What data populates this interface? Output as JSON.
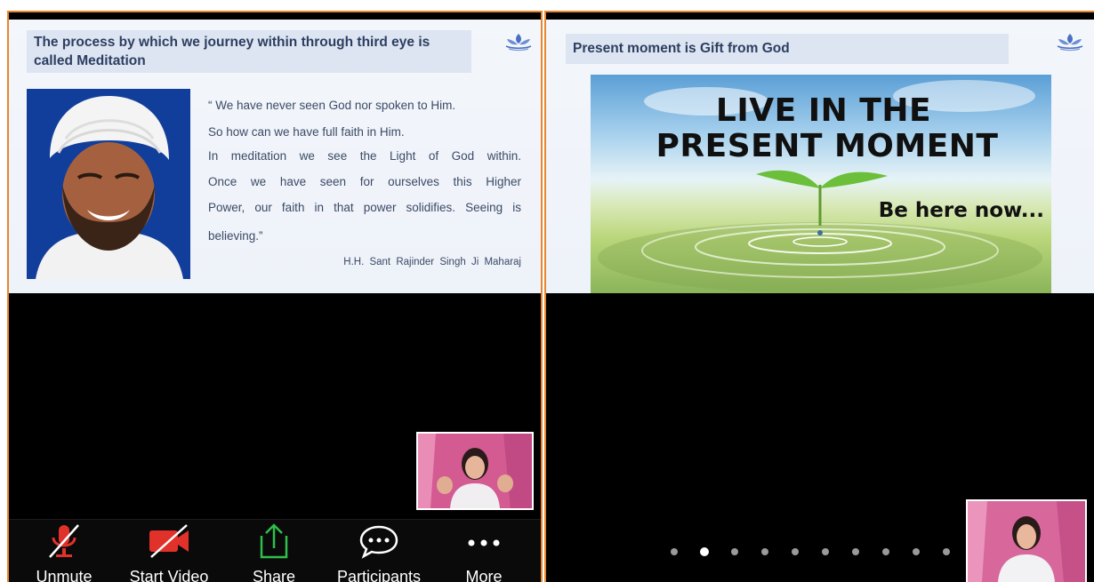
{
  "left_panel": {
    "slide": {
      "heading": "The process by which we journey within through third eye is called Meditation",
      "quote_lines": [
        "“ We have never seen God nor spoken to Him.",
        "So how can we have full faith in Him.",
        "In meditation we see the Light of God within.",
        "Once we have seen for ourselves this Higher",
        "Power, our faith in that power solidifies. Seeing is",
        "believing.”"
      ],
      "author": "H.H. Sant Rajinder Singh Ji Maharaj"
    },
    "toolbar": {
      "unmute": {
        "label": "Unmute",
        "icon": "microphone-muted-icon"
      },
      "start_video": {
        "label": "Start Video",
        "icon": "video-camera-off-icon"
      },
      "share": {
        "label": "Share",
        "icon": "share-upload-icon"
      },
      "participants": {
        "label": "Participants",
        "icon": "participants-chat-bubble-icon"
      },
      "more": {
        "label": "More",
        "icon": "more-dots-icon"
      }
    }
  },
  "right_panel": {
    "slide": {
      "heading": "Present moment is Gift from God",
      "poster_line1": "LIVE IN THE",
      "poster_line2": "PRESENT MOMENT",
      "poster_sub": "Be here now..."
    },
    "page_dots": {
      "count": 10,
      "active_index": 1
    }
  },
  "colors": {
    "panel_border": "#e8852f",
    "heading_bg": "#dde5f2",
    "heading_text": "#2c3e60",
    "mute_red": "#e0322b",
    "share_green": "#2fbf4a"
  }
}
